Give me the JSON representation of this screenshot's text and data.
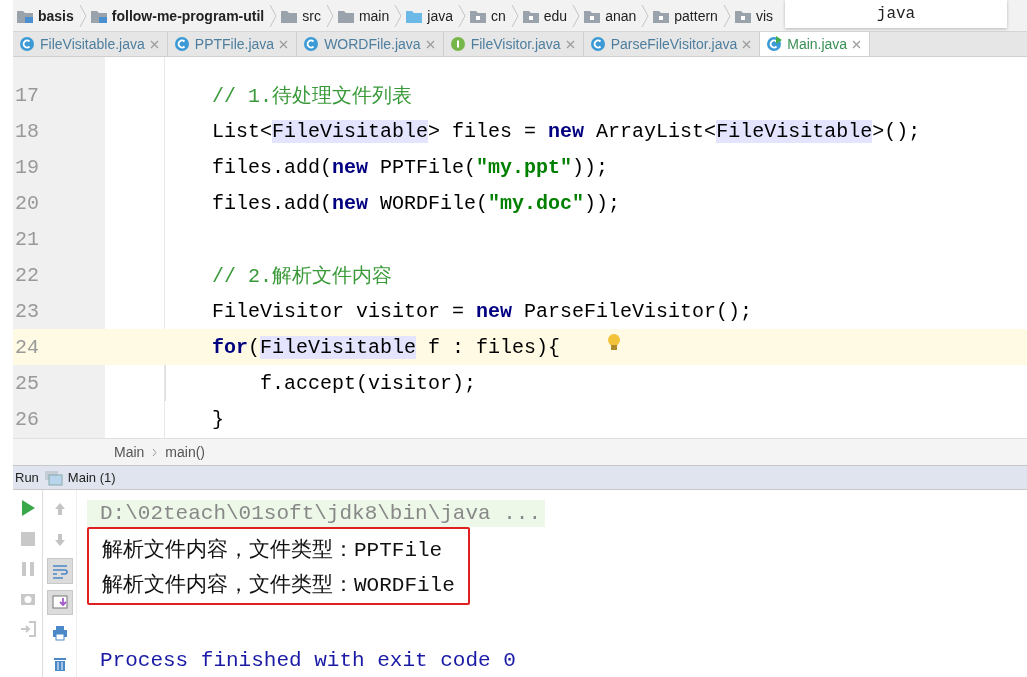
{
  "breadcrumbs": [
    {
      "label": "basis",
      "kind": "module"
    },
    {
      "label": "follow-me-program-util",
      "kind": "module"
    },
    {
      "label": "src",
      "kind": "folder"
    },
    {
      "label": "main",
      "kind": "folder"
    },
    {
      "label": "java",
      "kind": "source"
    },
    {
      "label": "cn",
      "kind": "package"
    },
    {
      "label": "edu",
      "kind": "package"
    },
    {
      "label": "anan",
      "kind": "package"
    },
    {
      "label": "pattern",
      "kind": "package"
    },
    {
      "label": "vis",
      "kind": "package"
    }
  ],
  "popup": {
    "text": "java"
  },
  "tabs": [
    {
      "label": "FileVisitable.java",
      "kind": "class",
      "selected": false
    },
    {
      "label": "PPTFile.java",
      "kind": "class",
      "selected": false
    },
    {
      "label": "WORDFile.java",
      "kind": "class",
      "selected": false
    },
    {
      "label": "FileVisitor.java",
      "kind": "interface",
      "selected": false
    },
    {
      "label": "ParseFileVisitor.java",
      "kind": "class",
      "selected": false
    },
    {
      "label": "Main.java",
      "kind": "main",
      "selected": true
    }
  ],
  "editor": {
    "lines": [
      {
        "number": "17",
        "segments": [
          {
            "text": "// 1.待处理文件列表",
            "kind": "comment"
          }
        ]
      },
      {
        "number": "18",
        "segments": [
          {
            "text": "List<",
            "kind": "plain"
          },
          {
            "text": "FileVisitable",
            "kind": "match"
          },
          {
            "text": "> files = ",
            "kind": "plain"
          },
          {
            "text": "new",
            "kind": "keyword"
          },
          {
            "text": " ArrayList<",
            "kind": "plain"
          },
          {
            "text": "FileVisitable",
            "kind": "match"
          },
          {
            "text": ">();",
            "kind": "plain"
          }
        ]
      },
      {
        "number": "19",
        "segments": [
          {
            "text": "files.add(",
            "kind": "plain"
          },
          {
            "text": "new",
            "kind": "keyword"
          },
          {
            "text": " PPTFile(",
            "kind": "plain"
          },
          {
            "text": "\"my.ppt\"",
            "kind": "string"
          },
          {
            "text": "));",
            "kind": "plain"
          }
        ]
      },
      {
        "number": "20",
        "segments": [
          {
            "text": "files.add(",
            "kind": "plain"
          },
          {
            "text": "new",
            "kind": "keyword"
          },
          {
            "text": " WORDFile(",
            "kind": "plain"
          },
          {
            "text": "\"my.doc\"",
            "kind": "string"
          },
          {
            "text": "));",
            "kind": "plain"
          }
        ]
      },
      {
        "number": "21"
      },
      {
        "number": "22",
        "segments": [
          {
            "text": "// 2.解析文件内容",
            "kind": "comment"
          }
        ]
      },
      {
        "number": "23",
        "segments": [
          {
            "text": "FileVisitor visitor = ",
            "kind": "plain"
          },
          {
            "text": "new",
            "kind": "keyword"
          },
          {
            "text": " ParseFileVisitor();",
            "kind": "plain"
          }
        ]
      },
      {
        "number": "24",
        "current": true,
        "bulb": true,
        "segments": [
          {
            "text": "for",
            "kind": "keyword"
          },
          {
            "text": "(",
            "kind": "plain"
          },
          {
            "text": "FileVisitable",
            "kind": "match"
          },
          {
            "text": " f : files){",
            "kind": "plain"
          }
        ],
        "children": [
          {
            "number": "25",
            "segments": [
              {
                "text": "f.accept(visitor);",
                "kind": "plain"
              }
            ]
          }
        ]
      },
      {
        "number": "26",
        "segments": [
          {
            "text": "}",
            "kind": "plain"
          }
        ]
      }
    ],
    "breadcrumb": [
      "Main",
      "main()"
    ]
  },
  "run": {
    "title": "Run",
    "tab": "Main (1)",
    "tools": [
      {
        "kind": "up",
        "on": false
      },
      {
        "kind": "down",
        "on": false
      },
      {
        "kind": "wrap",
        "on": true
      },
      {
        "kind": "scroll",
        "on": true
      },
      {
        "kind": "print",
        "on": false
      },
      {
        "kind": "trash",
        "on": false
      }
    ],
    "console": [
      {
        "kind": "command",
        "text": "D:\\02teach\\01soft\\jdk8\\bin\\java ..."
      },
      {
        "kind": "output",
        "boxed": true,
        "text": "解析文件内容，文件类型：PPTFile"
      },
      {
        "kind": "output",
        "boxed": true,
        "text": "解析文件内容，文件类型：WORDFile"
      },
      {
        "kind": "exit",
        "text": "Process finished with exit code 0"
      }
    ]
  }
}
